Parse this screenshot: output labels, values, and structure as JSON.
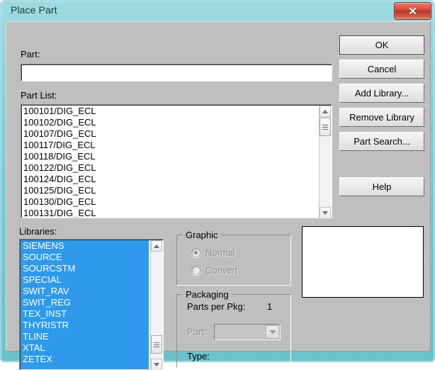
{
  "window": {
    "title": "Place Part",
    "close_label": "✕",
    "accent_titlebar": "#7ecdd4",
    "close_button_color": "#b93525",
    "dialog_face": "#bfbfbf"
  },
  "part": {
    "label": "Part:",
    "value": "",
    "placeholder": ""
  },
  "part_list": {
    "label": "Part List:",
    "items": [
      "100101/DIG_ECL",
      "100102/DIG_ECL",
      "100107/DIG_ECL",
      "100117/DIG_ECL",
      "100118/DIG_ECL",
      "100122/DIG_ECL",
      "100124/DIG_ECL",
      "100125/DIG_ECL",
      "100130/DIG_ECL",
      "100131/DIG_ECL"
    ],
    "scrollbar": {
      "up_icon": "scroll-up-arrow",
      "down_icon": "scroll-down-arrow",
      "thumb_icon": "scroll-thumb"
    }
  },
  "libraries": {
    "label": "Libraries:",
    "items": [
      "SIEMENS",
      "SOURCE",
      "SOURCSTM",
      "SPECIAL",
      "SWIT_RAV",
      "SWIT_REG",
      "TEX_INST",
      "THYRISTR",
      "TLINE",
      "XTAL",
      "ZETEX"
    ],
    "selection_color": "#2f9aec",
    "all_selected": true
  },
  "buttons": [
    {
      "id": "ok",
      "label": "OK",
      "default": true
    },
    {
      "id": "cancel",
      "label": "Cancel",
      "default": false
    },
    {
      "id": "add-library",
      "label": "Add Library...",
      "default": false
    },
    {
      "id": "remove-library",
      "label": "Remove Library",
      "default": false
    },
    {
      "id": "part-search",
      "label": "Part Search...",
      "default": false
    },
    {
      "id": "help",
      "label": "Help",
      "default": false
    }
  ],
  "graphic": {
    "title": "Graphic",
    "options": [
      {
        "label": "Normal",
        "checked": true,
        "disabled": true
      },
      {
        "label": "Convert",
        "checked": false,
        "disabled": true
      }
    ]
  },
  "packaging": {
    "title": "Packaging",
    "parts_per_pkg_label": "Parts per Pkg:",
    "parts_per_pkg_value": "1",
    "part_label": "Part:",
    "part_value": "",
    "type_label": "Type:",
    "type_value": ""
  },
  "preview": {
    "content": ""
  }
}
